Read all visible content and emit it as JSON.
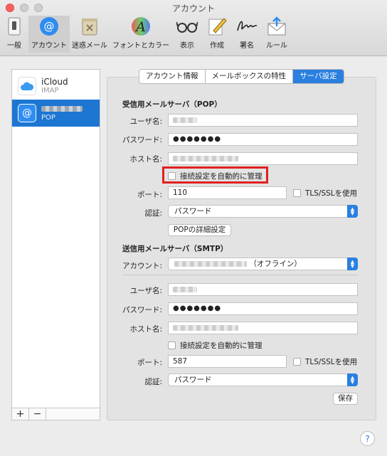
{
  "window": {
    "title": "アカウント"
  },
  "toolbar": {
    "items": [
      {
        "label": "一般",
        "icon": "switch-icon"
      },
      {
        "label": "アカウント",
        "icon": "at-sign-icon"
      },
      {
        "label": "迷惑メール",
        "icon": "junk-trash-icon"
      },
      {
        "label": "フォントとカラー",
        "icon": "font-color-icon"
      },
      {
        "label": "表示",
        "icon": "glasses-icon"
      },
      {
        "label": "作成",
        "icon": "compose-pencil-icon"
      },
      {
        "label": "署名",
        "icon": "signature-icon"
      },
      {
        "label": "ルール",
        "icon": "rules-envelope-icon"
      }
    ],
    "active_index": 1
  },
  "sidebar": {
    "accounts": [
      {
        "name": "iCloud",
        "type": "IMAP",
        "icon": "cloud-icon"
      },
      {
        "name": "…",
        "type": "POP",
        "icon": "at-sign-icon"
      }
    ],
    "selected_index": 1,
    "add_label": "+",
    "remove_label": "−"
  },
  "tabs": [
    "アカウント情報",
    "メールボックスの特性",
    "サーバ設定"
  ],
  "active_tab": 2,
  "incoming": {
    "title": "受信用メールサーバ（POP）",
    "user_label": "ユーザ名:",
    "password_label": "パスワード:",
    "password_value": "●●●●●●●",
    "host_label": "ホスト名:",
    "auto_manage_label": "接続設定を自動的に管理",
    "port_label": "ポート:",
    "port_value": "110",
    "tls_label": "TLS/SSLを使用",
    "auth_label": "認証:",
    "auth_value": "パスワード",
    "advanced_button": "POPの詳細設定"
  },
  "outgoing": {
    "title": "送信用メールサーバ（SMTP）",
    "account_label": "アカウント:",
    "account_suffix": "（オフライン）",
    "user_label": "ユーザ名:",
    "password_label": "パスワード:",
    "password_value": "●●●●●●●",
    "host_label": "ホスト名:",
    "auto_manage_label": "接続設定を自動的に管理",
    "port_label": "ポート:",
    "port_value": "587",
    "tls_label": "TLS/SSLを使用",
    "auth_label": "認証:",
    "auth_value": "パスワード",
    "save_button": "保存"
  },
  "help_label": "?",
  "colors": {
    "accent": "#2a7fe0",
    "selection": "#1c76d2",
    "highlight_box": "#e02020"
  }
}
